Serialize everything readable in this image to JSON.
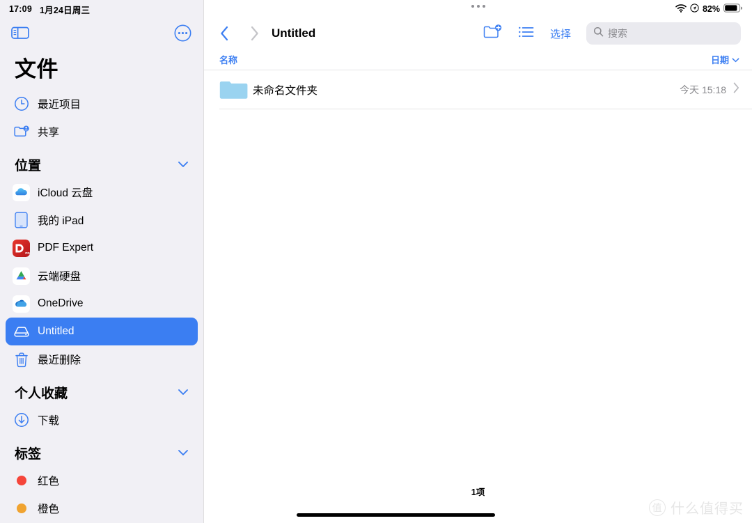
{
  "status_bar": {
    "time": "17:09",
    "date": "1月24日周三",
    "battery_percent": "82%",
    "wifi_icon": "wifi-icon",
    "location_icon": "location-indicator-icon",
    "battery_icon": "battery-icon"
  },
  "sidebar": {
    "toggle_icon": "sidebar-toggle-icon",
    "more_icon": "more-ellipsis-icon",
    "title": "文件",
    "top_items": [
      {
        "label": "最近项目",
        "icon": "clock-icon"
      },
      {
        "label": "共享",
        "icon": "shared-folder-icon"
      }
    ],
    "sections": [
      {
        "title": "位置",
        "collapse_icon": "chevron-down-icon",
        "items": [
          {
            "label": "iCloud 云盘",
            "icon": "icloud-icon",
            "selected": false
          },
          {
            "label": "我的 iPad",
            "icon": "ipad-icon",
            "selected": false
          },
          {
            "label": "PDF Expert",
            "icon": "pdf-expert-icon",
            "selected": false
          },
          {
            "label": "云端硬盘",
            "icon": "google-drive-icon",
            "selected": false
          },
          {
            "label": "OneDrive",
            "icon": "onedrive-icon",
            "selected": false
          },
          {
            "label": "Untitled",
            "icon": "external-drive-icon",
            "selected": true
          },
          {
            "label": "最近删除",
            "icon": "trash-icon",
            "selected": false
          }
        ]
      },
      {
        "title": "个人收藏",
        "collapse_icon": "chevron-down-icon",
        "items": [
          {
            "label": "下载",
            "icon": "download-circle-icon",
            "selected": false
          }
        ]
      },
      {
        "title": "标签",
        "collapse_icon": "chevron-down-icon",
        "items": [
          {
            "label": "红色",
            "icon": "tag-dot-icon",
            "color": "#f5453a",
            "selected": false
          },
          {
            "label": "橙色",
            "icon": "tag-dot-icon",
            "color": "#f0a330",
            "selected": false
          }
        ]
      }
    ]
  },
  "nav": {
    "back_icon": "chevron-left-icon",
    "forward_icon": "chevron-right-icon",
    "title": "Untitled",
    "new_folder_icon": "new-folder-icon",
    "view_list_icon": "list-view-icon",
    "select_label": "选择",
    "search_icon": "search-icon",
    "search_placeholder": "搜索",
    "search_value": ""
  },
  "columns": {
    "name": "名称",
    "date": "日期",
    "sort_icon": "chevron-down-icon"
  },
  "files": [
    {
      "name": "未命名文件夹",
      "date": "今天 15:18",
      "icon": "folder-icon",
      "disclosure_icon": "chevron-right-icon"
    }
  ],
  "footer": {
    "item_count": "1项"
  },
  "watermark": {
    "mark": "值",
    "text": "什么值得买"
  },
  "colors": {
    "accent_blue": "#3b7ef2",
    "sidebar_bg": "#f1f0f5",
    "folder_blue": "#9ad3f0",
    "muted_gray": "#8a8a8e"
  }
}
